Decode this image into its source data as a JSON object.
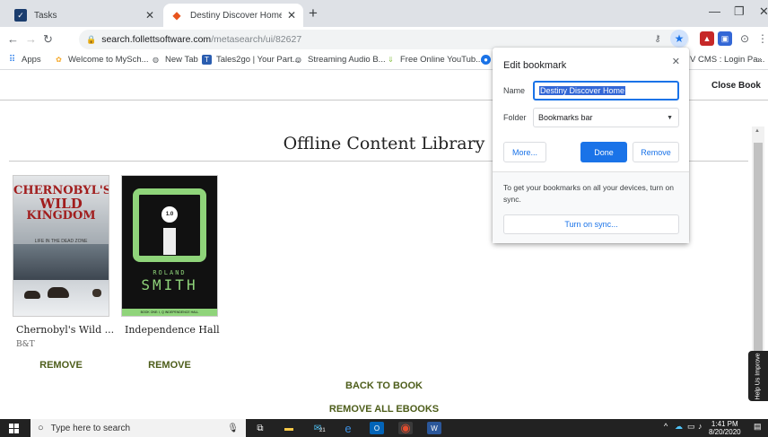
{
  "tabs": [
    {
      "label": "Tasks",
      "icon": "tasks-icon",
      "active": false
    },
    {
      "label": "Destiny Discover Home",
      "icon": "destiny-icon",
      "active": true
    }
  ],
  "address": {
    "host": "search.follettsoftware.com",
    "path": "/metasearch/ui/82627"
  },
  "bookmarks": [
    {
      "label": "Apps",
      "icon": "apps-grid-icon"
    },
    {
      "label": "Welcome to MySch...",
      "icon": "school-icon"
    },
    {
      "label": "New Tab",
      "icon": "globe-icon"
    },
    {
      "label": "Tales2go | Your Part...",
      "icon": "tales2go-icon"
    },
    {
      "label": "Streaming Audio B...",
      "icon": "globe-icon"
    },
    {
      "label": "Free Online YouTub...",
      "icon": "download-icon"
    },
    {
      "label": "V CMS : Login Pa...",
      "icon": "cms-icon"
    }
  ],
  "page": {
    "close_book": "Close Book",
    "heading": "Offline Content Library",
    "books": [
      {
        "title": "Chernobyl's Wild ...",
        "author": "B&T",
        "action": "REMOVE",
        "cover_text": [
          "CHERNOBYL'S",
          "WILD",
          "KINGDOM"
        ],
        "cover_sub": "LIFE IN THE DEAD ZONE"
      },
      {
        "title": "Independence Hall",
        "author": "",
        "action": "REMOVE",
        "cover_badge": "1.0",
        "cover_text": [
          "ROLAND",
          "SMITH"
        ],
        "cover_sub": "BOOK ONE: I, Q INDEPENDENCE HALL"
      }
    ],
    "back_to_book": "BACK TO BOOK",
    "remove_all": "REMOVE ALL EBOOKS",
    "help_tab": "Help Us Improve"
  },
  "bookmark_popup": {
    "title": "Edit bookmark",
    "name_label": "Name",
    "name_value": "Destiny Discover Home",
    "folder_label": "Folder",
    "folder_value": "Bookmarks bar",
    "more_label": "More...",
    "done_label": "Done",
    "remove_label": "Remove",
    "sync_message": "To get your bookmarks on all your devices, turn on sync.",
    "sync_button": "Turn on sync..."
  },
  "taskbar": {
    "search_placeholder": "Type here to search",
    "time": "1:41 PM",
    "date": "8/20/2020",
    "mail_badge": "21"
  },
  "colors": {
    "accent_blue": "#1a73e8",
    "link_green": "#4d5d1a",
    "chrome_gray": "#dee1e6"
  }
}
